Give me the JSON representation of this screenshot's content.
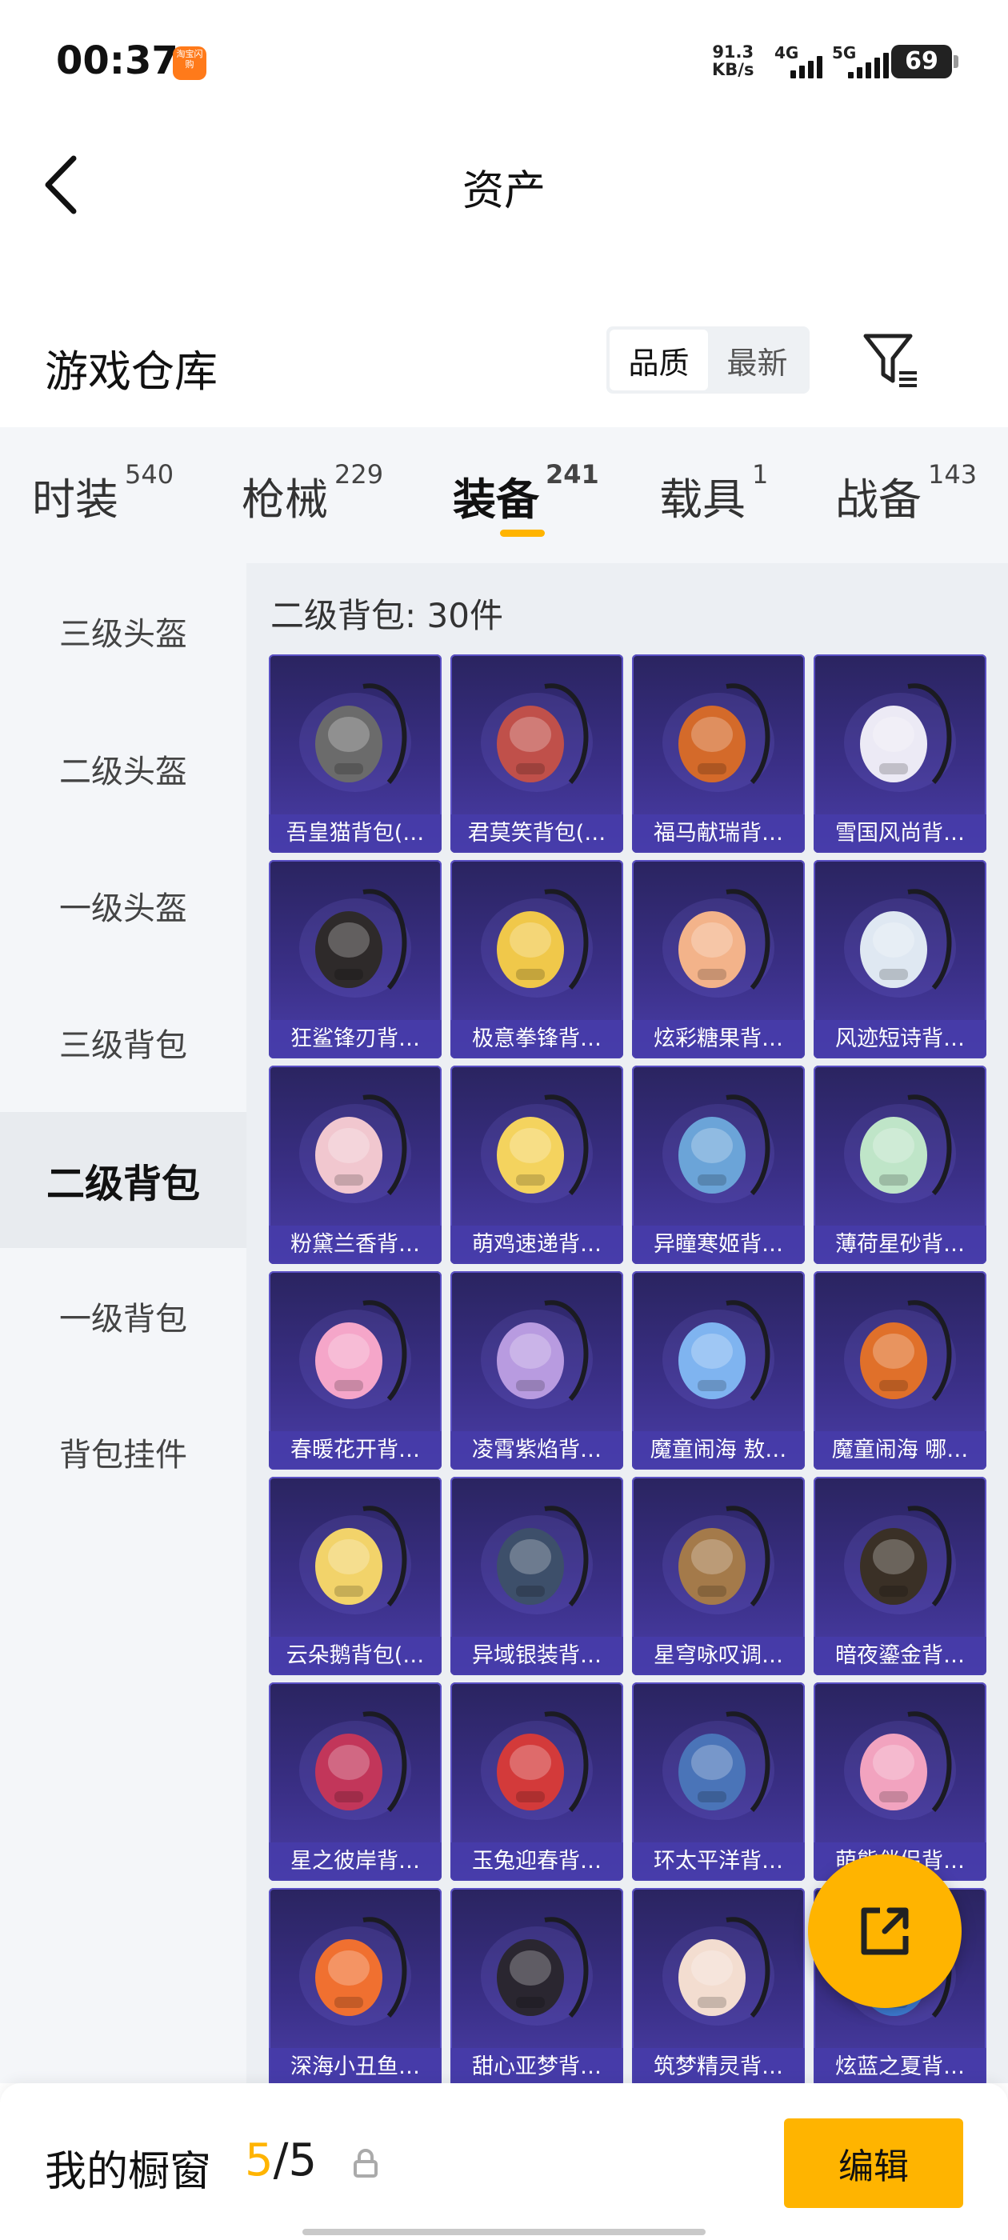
{
  "status_bar": {
    "time": "00:37",
    "app_icon_text": "淘宝闪购",
    "speed_value": "91.3",
    "speed_unit": "KB/s",
    "net1": "4G",
    "net2": "5G",
    "battery": "69"
  },
  "header": {
    "title": "资产"
  },
  "warehouse": {
    "title": "游戏仓库",
    "sort_options": [
      "品质",
      "最新"
    ],
    "sort_active": "品质"
  },
  "tabs": [
    {
      "label": "时装",
      "count": "540"
    },
    {
      "label": "枪械",
      "count": "229"
    },
    {
      "label": "装备",
      "count": "241"
    },
    {
      "label": "载具",
      "count": "1"
    },
    {
      "label": "战备",
      "count": "143"
    }
  ],
  "sidebar": {
    "items": [
      "三级头盔",
      "二级头盔",
      "一级头盔",
      "三级背包",
      "二级背包",
      "一级背包",
      "背包挂件"
    ],
    "active": "二级背包"
  },
  "panel": {
    "header": "二级背包: 30件"
  },
  "items": [
    {
      "name": "吾皇猫背包(…",
      "icon": "cat-backpack-icon",
      "color": "#6b6b6b"
    },
    {
      "name": "君莫笑背包(…",
      "icon": "emblem-backpack-icon",
      "color": "#c0504a"
    },
    {
      "name": "福马献瑞背…",
      "icon": "horse-backpack-icon",
      "color": "#d46a2a"
    },
    {
      "name": "雪国风尚背…",
      "icon": "snowman-backpack-icon",
      "color": "#eceaf5"
    },
    {
      "name": "狂鲨锋刃背…",
      "icon": "shark-backpack-icon",
      "color": "#2e2a2a"
    },
    {
      "name": "极意拳锋背…",
      "icon": "box-backpack-icon",
      "color": "#f0c84a"
    },
    {
      "name": "炫彩糖果背…",
      "icon": "candy-backpack-icon",
      "color": "#f3b38a"
    },
    {
      "name": "风迹短诗背…",
      "icon": "boxy-backpack-icon",
      "color": "#dfe8f2"
    },
    {
      "name": "粉黛兰香背…",
      "icon": "pink-backpack-icon",
      "color": "#f1c7cf"
    },
    {
      "name": "萌鸡速递背…",
      "icon": "chick-backpack-icon",
      "color": "#f4d35e"
    },
    {
      "name": "异瞳寒姬背…",
      "icon": "tech-backpack-icon",
      "color": "#6ba4d8"
    },
    {
      "name": "薄荷星砂背…",
      "icon": "mint-backpack-icon",
      "color": "#bfe5c8"
    },
    {
      "name": "春暖花开背…",
      "icon": "butterfly-backpack-icon",
      "color": "#f5a6c9"
    },
    {
      "name": "凌霄紫焰背…",
      "icon": "purple-flame-backpack-icon",
      "color": "#b89be0"
    },
    {
      "name": "魔童闹海 敖…",
      "icon": "orb-pendant-icon",
      "color": "#7fb4f0"
    },
    {
      "name": "魔童闹海 哪…",
      "icon": "flame-pendant-icon",
      "color": "#e0702a"
    },
    {
      "name": "云朵鹅背包(…",
      "icon": "goose-backpack-icon",
      "color": "#f2d36a"
    },
    {
      "name": "异域银装背…",
      "icon": "silver-backpack-icon",
      "color": "#3d4f6a"
    },
    {
      "name": "星穹咏叹调…",
      "icon": "bronze-backpack-icon",
      "color": "#a47a4a"
    },
    {
      "name": "暗夜鎏金背…",
      "icon": "gold-backpack-icon",
      "color": "#3a3026"
    },
    {
      "name": "星之彼岸背…",
      "icon": "space-backpack-icon",
      "color": "#c2365a"
    },
    {
      "name": "玉兔迎春背…",
      "icon": "rabbit-backpack-icon",
      "color": "#d33a3a"
    },
    {
      "name": "环太平洋背…",
      "icon": "mech-backpack-icon",
      "color": "#4a74b8"
    },
    {
      "name": "萌熊伴侣背…",
      "icon": "bear-backpack-icon",
      "color": "#f2a3bf"
    },
    {
      "name": "深海小丑鱼…",
      "icon": "clownfish-backpack-icon",
      "color": "#f07030"
    },
    {
      "name": "甜心亚梦背…",
      "icon": "heart-backpack-icon",
      "color": "#2a2630"
    },
    {
      "name": "筑梦精灵背…",
      "icon": "fairy-backpack-icon",
      "color": "#f3ddd0"
    },
    {
      "name": "炫蓝之夏背…",
      "icon": "blue-backpack-icon",
      "color": "#3f7fd8"
    }
  ],
  "showcase": {
    "label": "我的橱窗",
    "current": "5",
    "separator": "/",
    "total": "5",
    "edit_label": "编辑"
  },
  "colors": {
    "accent": "#ffb400",
    "card_bg": "#3a2f86",
    "panel_bg": "#eceff3"
  }
}
